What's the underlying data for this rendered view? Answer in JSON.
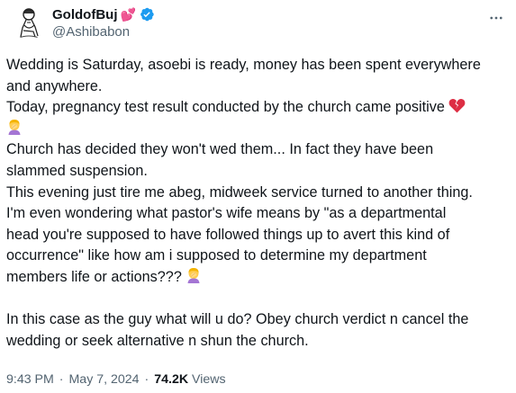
{
  "author": {
    "display_name": "GoldofBuj",
    "handle": "@Ashibabon",
    "verified": true,
    "name_emoji": "💕"
  },
  "tweet": {
    "lines": [
      "Wedding is Saturday, asoebi is ready, money has been spent everywhere",
      "and anywhere.",
      "Today, pregnancy test result conducted by the church came positive",
      "",
      "Church has decided they won't wed them... In fact they have been",
      "slammed suspension.",
      "This evening just tire me abeg, midweek service turned to another thing.",
      "I'm even wondering what pastor's wife means by \"as a departmental",
      "head you're supposed to have followed things up to avert this kind of",
      "occurrence\" like how am i supposed to determine my department",
      "members life or actions???",
      "",
      "In this case as the guy what will u do? Obey church verdict n cancel the",
      "wedding or seek alternative n shun the church."
    ],
    "emojis": {
      "broken_heart": "broken-heart-icon",
      "facepalm": "woman-facepalming-icon"
    }
  },
  "meta": {
    "time": "9:43 PM",
    "date": "May 7, 2024",
    "views_count": "74.2K",
    "views_label": "Views",
    "separator": "·"
  },
  "colors": {
    "text": "#0f1419",
    "secondary": "#536471",
    "verified": "#1d9bf0",
    "heart": "#e0245e"
  }
}
